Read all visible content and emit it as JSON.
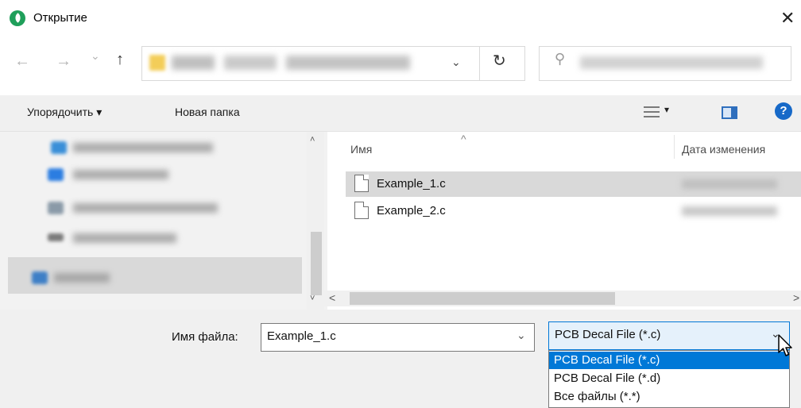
{
  "window": {
    "title": "Открытие",
    "close_glyph": "✕"
  },
  "nav": {
    "back_glyph": "←",
    "forward_glyph": "→",
    "recent_glyph": "⌄",
    "up_glyph": "↑",
    "address_chevron": "⌄",
    "refresh_glyph": "↻",
    "search_glyph": "⚲"
  },
  "toolbar": {
    "organize_label": "Упорядочить ▾",
    "new_folder_label": "Новая папка",
    "view_caret": "▾",
    "help_label": "?"
  },
  "file_list": {
    "columns": {
      "name": "Имя",
      "date_modified": "Дата изменения"
    },
    "files": [
      {
        "name": "Example_1.c"
      },
      {
        "name": "Example_2.c"
      }
    ]
  },
  "scroll": {
    "up": "˄",
    "down": "˅",
    "left": "<",
    "right": ">"
  },
  "bottom": {
    "filename_label": "Имя файла:",
    "filename_value": "Example_1.c",
    "filename_chevron": "⌄",
    "filetype_value": "PCB Decal File (*.c)",
    "filetype_chevron": "⌄",
    "filetype_options": [
      "PCB Decal File (*.c)",
      "PCB Decal File (*.d)",
      "Все файлы (*.*)"
    ]
  },
  "colors": {
    "accent": "#0078d7",
    "selection_gray": "#d9d9d9",
    "app_icon": "#1f9f5a"
  }
}
